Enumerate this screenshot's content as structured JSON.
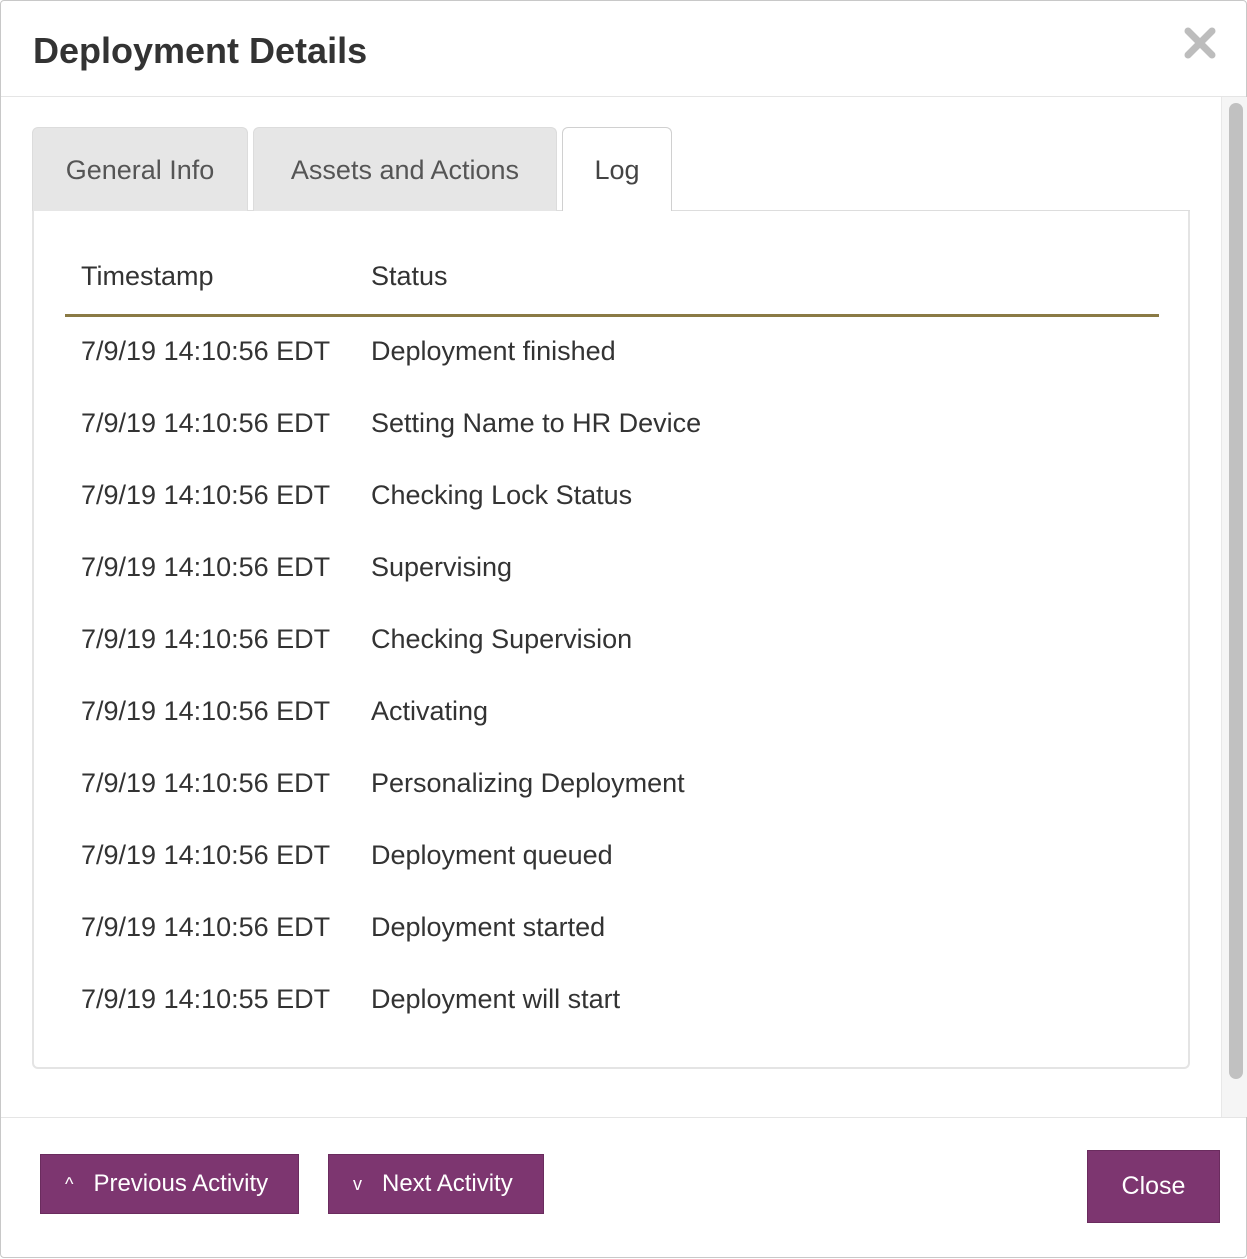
{
  "dialog": {
    "title": "Deployment Details",
    "close_icon": "close-x-icon"
  },
  "tabs": [
    {
      "label": "General Info",
      "active": false
    },
    {
      "label": "Assets and Actions",
      "active": false
    },
    {
      "label": "Log",
      "active": true
    }
  ],
  "log": {
    "columns": [
      "Timestamp",
      "Status"
    ],
    "rows": [
      {
        "timestamp": "7/9/19 14:10:56 EDT",
        "status": "Deployment finished"
      },
      {
        "timestamp": "7/9/19 14:10:56 EDT",
        "status": "Setting Name to HR Device"
      },
      {
        "timestamp": "7/9/19 14:10:56 EDT",
        "status": "Checking Lock Status"
      },
      {
        "timestamp": "7/9/19 14:10:56 EDT",
        "status": "Supervising"
      },
      {
        "timestamp": "7/9/19 14:10:56 EDT",
        "status": "Checking Supervision"
      },
      {
        "timestamp": "7/9/19 14:10:56 EDT",
        "status": "Activating"
      },
      {
        "timestamp": "7/9/19 14:10:56 EDT",
        "status": "Personalizing Deployment"
      },
      {
        "timestamp": "7/9/19 14:10:56 EDT",
        "status": "Deployment queued"
      },
      {
        "timestamp": "7/9/19 14:10:56 EDT",
        "status": "Deployment started"
      },
      {
        "timestamp": "7/9/19 14:10:55 EDT",
        "status": "Deployment will start"
      }
    ]
  },
  "footer": {
    "prev_label": "Previous Activity",
    "prev_icon": "^",
    "next_label": "Next Activity",
    "next_icon": "v",
    "close_label": "Close"
  },
  "colors": {
    "button": "#7d3670",
    "header_rule": "#8a7a45",
    "tab_inactive": "#e6e6e6"
  }
}
